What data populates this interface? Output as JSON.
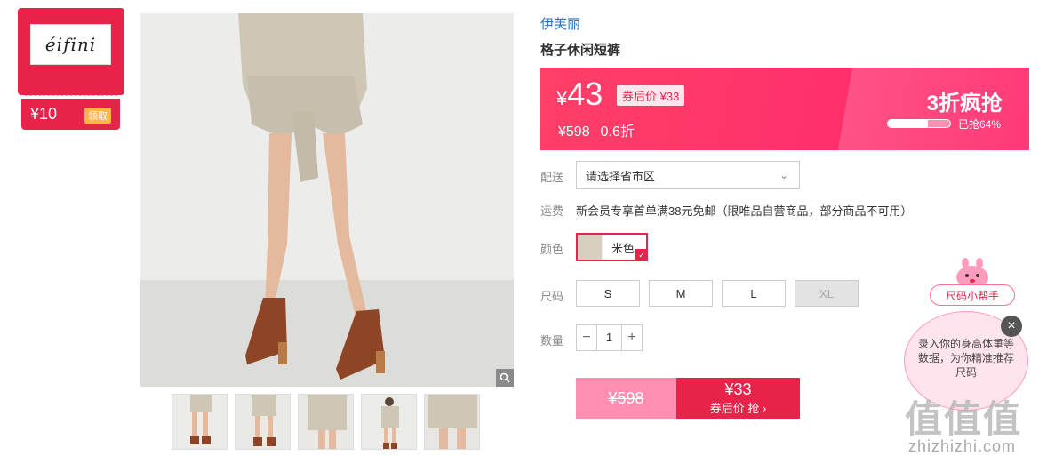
{
  "brand_card": {
    "logo_text": "éifini",
    "coupon_amount": "¥10",
    "coupon_button": "领取"
  },
  "product": {
    "brand": "伊芙丽",
    "title": "格子休闲短裤"
  },
  "price": {
    "yen": "¥",
    "current": "43",
    "coupon_price": "券后价 ¥33",
    "original": "¥598",
    "discount": "0.6折",
    "flash_title": "3折疯抢",
    "sold_percent": 64,
    "sold_text": "已抢64%"
  },
  "delivery": {
    "label": "配送",
    "placeholder": "请选择省市区"
  },
  "shipping": {
    "label": "运费",
    "text": "新会员专享首单满38元免邮（限唯品自营商品，部分商品不可用）"
  },
  "color": {
    "label": "颜色",
    "selected": "米色"
  },
  "size": {
    "label": "尺码",
    "options": [
      "S",
      "M",
      "L",
      "XL"
    ]
  },
  "quantity": {
    "label": "数量",
    "minus": "−",
    "value": "1",
    "plus": "+"
  },
  "buy_bar": {
    "original": "¥598",
    "coupon_price": "¥33",
    "action": "券后价 抢 ›"
  },
  "size_helper": {
    "tag": "尺码小帮手",
    "bubble": "录入你的身高体重等数据，为你精准推荐尺码",
    "close": "×"
  },
  "watermark": {
    "main": "值值值",
    "sub": "zhizhizhi.com"
  },
  "colors": {
    "accent": "#e8234a",
    "brand_link": "#2a73c6"
  }
}
